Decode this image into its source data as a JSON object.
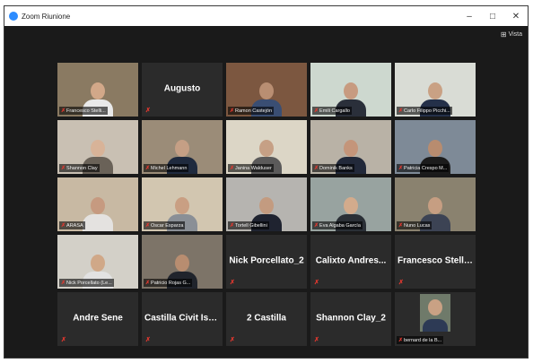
{
  "window": {
    "title": "Zoom Riunione",
    "minimize": "–",
    "maximize": "□",
    "close": "✕"
  },
  "toolbar": {
    "view_label": "Vista",
    "view_icon": "⊞"
  },
  "mic_glyph": "✗",
  "tiles": [
    {
      "name": "Francesco Stelli...",
      "video": true,
      "bg": "#8a7a62",
      "shirt": "#e9e9e9",
      "skin": "#d2a889"
    },
    {
      "name": "Augusto",
      "video": false
    },
    {
      "name": "Ramon Castejón",
      "video": true,
      "bg": "#7c5740",
      "shirt": "#3a4e73",
      "skin": "#b98e72"
    },
    {
      "name": "Emili Cargallo",
      "video": true,
      "bg": "#cdd8cf",
      "shirt": "#2a2f3a",
      "skin": "#c79b80"
    },
    {
      "name": "Carlo Filippo Picchi...",
      "video": true,
      "bg": "#d9dcd5",
      "shirt": "#243049",
      "skin": "#c9a184",
      "highlight": true
    },
    {
      "name": "Shannon Clay",
      "video": true,
      "bg": "#c9c0b3",
      "shirt": "#6a6258",
      "skin": "#d8b398"
    },
    {
      "name": "Michel Lehmann",
      "video": true,
      "bg": "#9b8c78",
      "shirt": "#1f2a3e",
      "skin": "#c59f85"
    },
    {
      "name": "Janina Walduser",
      "video": true,
      "bg": "#dcd6c6",
      "shirt": "#5b5a5a",
      "skin": "#c6a085"
    },
    {
      "name": "Dominik Banks",
      "video": true,
      "bg": "#b9b2a6",
      "shirt": "#22293a",
      "skin": "#c4957a"
    },
    {
      "name": "Patricia Crespo M...",
      "video": true,
      "bg": "#7e8a97",
      "shirt": "#1c1c1c",
      "skin": "#b88c6f"
    },
    {
      "name": "ARASA",
      "video": true,
      "bg": "#c8b9a3",
      "shirt": "#e4e2e0",
      "skin": "#c69a80"
    },
    {
      "name": "Oscar Esparza",
      "video": true,
      "bg": "#d2c6b0",
      "shirt": "#8a8f96",
      "skin": "#c99f83"
    },
    {
      "name": "Tortell Gibellini",
      "video": true,
      "bg": "#b6b4b0",
      "shirt": "#1f2330",
      "skin": "#c39b80"
    },
    {
      "name": "Eva Algaba García",
      "video": true,
      "bg": "#98a3a0",
      "shirt": "#2a2f36",
      "skin": "#d3ab8c"
    },
    {
      "name": "Nuno Lucas",
      "video": true,
      "bg": "#8a826f",
      "shirt": "#3c4354",
      "skin": "#c69e82"
    },
    {
      "name": "Nick Porcellato (Le...",
      "video": true,
      "bg": "#d3d0c8",
      "shirt": "#e2e2e2",
      "skin": "#d0a888"
    },
    {
      "name": "Patricio Rojas G...",
      "video": true,
      "bg": "#7d7468",
      "shirt": "#20242c",
      "skin": "#b88d70"
    },
    {
      "name": "Nick Porcellato_2",
      "video": false
    },
    {
      "name": "Calixto  Andres...",
      "video": false
    },
    {
      "name": "Francesco Stellini",
      "video": false
    },
    {
      "name": "Andre Sene",
      "video": false
    },
    {
      "name": "Castilla  Civit  Isa...",
      "video": false
    },
    {
      "name": "2 Castilla",
      "video": false
    },
    {
      "name": "Shannon Clay_2",
      "video": false
    },
    {
      "name": "bernard de la B...",
      "video": true,
      "mini": true,
      "bg": "#6f7a6a",
      "shirt": "#2d3a55",
      "skin": "#c9a184"
    }
  ]
}
